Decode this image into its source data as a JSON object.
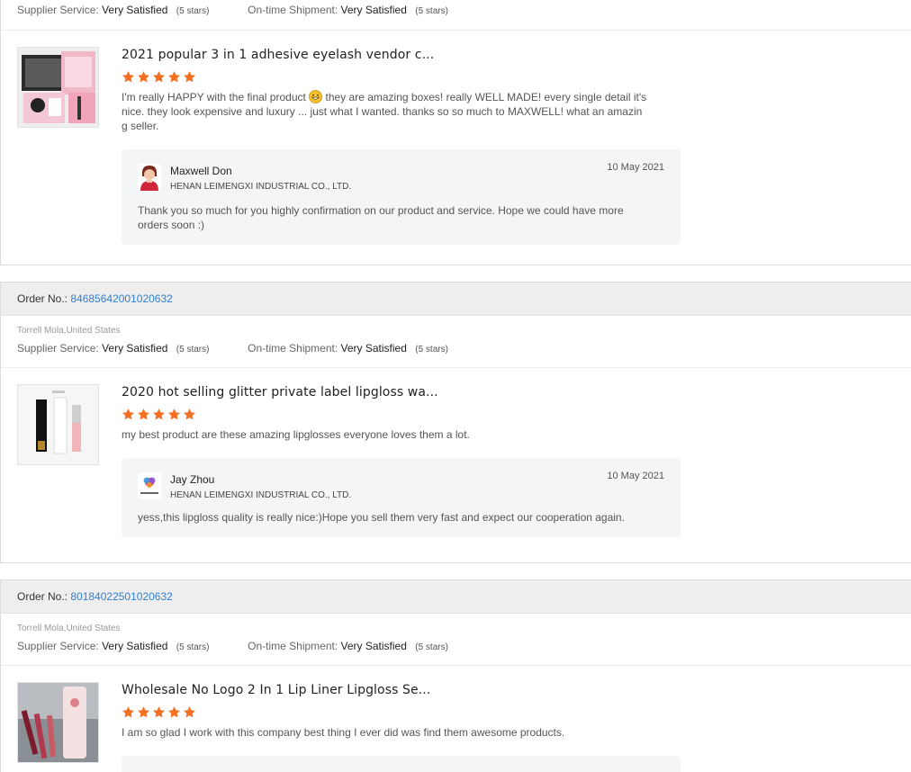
{
  "colors": {
    "accent_link": "#2f7fd0",
    "star": "#f36f21",
    "reply_bg": "#f4f5f7",
    "header_bg": "#eeeeee"
  },
  "top_ratings": {
    "supplier_label": "Supplier Service:",
    "supplier_value": "Very Satisfied",
    "supplier_stars": "(5 stars)",
    "shipment_label": "On-time Shipment:",
    "shipment_value": "Very Satisfied",
    "shipment_stars": "(5 stars)"
  },
  "reviews": [
    {
      "product_title": "2021 popular 3 in 1 adhesive eyelash vendor c...",
      "thumb_icon": "eyelash-box-image",
      "star_count": 5,
      "text_before_emoji": "I'm really HAPPY with the final product ",
      "emoji_icon": "grinning-face-icon",
      "text_after_emoji": " they are amazing boxes! really WELL MADE! every single detail it's nice. they look expensive and luxury ... just what  I wanted. thanks so so much to MAXWELL! what an amazing seller.",
      "reply": {
        "name": "Maxwell Don",
        "company": "HENAN LEIMENGXI INDUSTRIAL CO., LTD.",
        "date": "10 May 2021",
        "text": "Thank you so much for you highly confirmation on our product and service. Hope we could have more orders soon :)"
      }
    },
    {
      "order_label": "Order No.:",
      "order_no": "84685642001020632",
      "buyer": "Torrell Mola,United States",
      "supplier_label": "Supplier Service:",
      "supplier_value": "Very Satisfied",
      "supplier_stars": "(5 stars)",
      "shipment_label": "On-time Shipment:",
      "shipment_value": "Very Satisfied",
      "shipment_stars": "(5 stars)",
      "product_title": "2020 hot selling glitter private label lipgloss wa...",
      "thumb_icon": "lipgloss-tubes-image",
      "star_count": 5,
      "text": "my best product are these amazing lipglosses everyone loves them a lot.",
      "reply": {
        "name": "Jay Zhou",
        "company": "HENAN LEIMENGXI INDUSTRIAL CO., LTD.",
        "date": "10 May 2021",
        "text": "yess,this lipgloss quality is really nice:)Hope you sell them very fast and expect our cooperation again."
      }
    },
    {
      "order_label": "Order No.:",
      "order_no": "80184022501020632",
      "buyer": "Torrell Mola,United States",
      "supplier_label": "Supplier Service:",
      "supplier_value": "Very Satisfied",
      "supplier_stars": "(5 stars)",
      "shipment_label": "On-time Shipment:",
      "shipment_value": "Very Satisfied",
      "shipment_stars": "(5 stars)",
      "product_title": "Wholesale No Logo 2 In 1 Lip Liner Lipgloss Se...",
      "thumb_icon": "lip-liner-set-image",
      "star_count": 5,
      "text": "I am so glad I work with this company best thing I ever did was find them awesome products."
    }
  ]
}
